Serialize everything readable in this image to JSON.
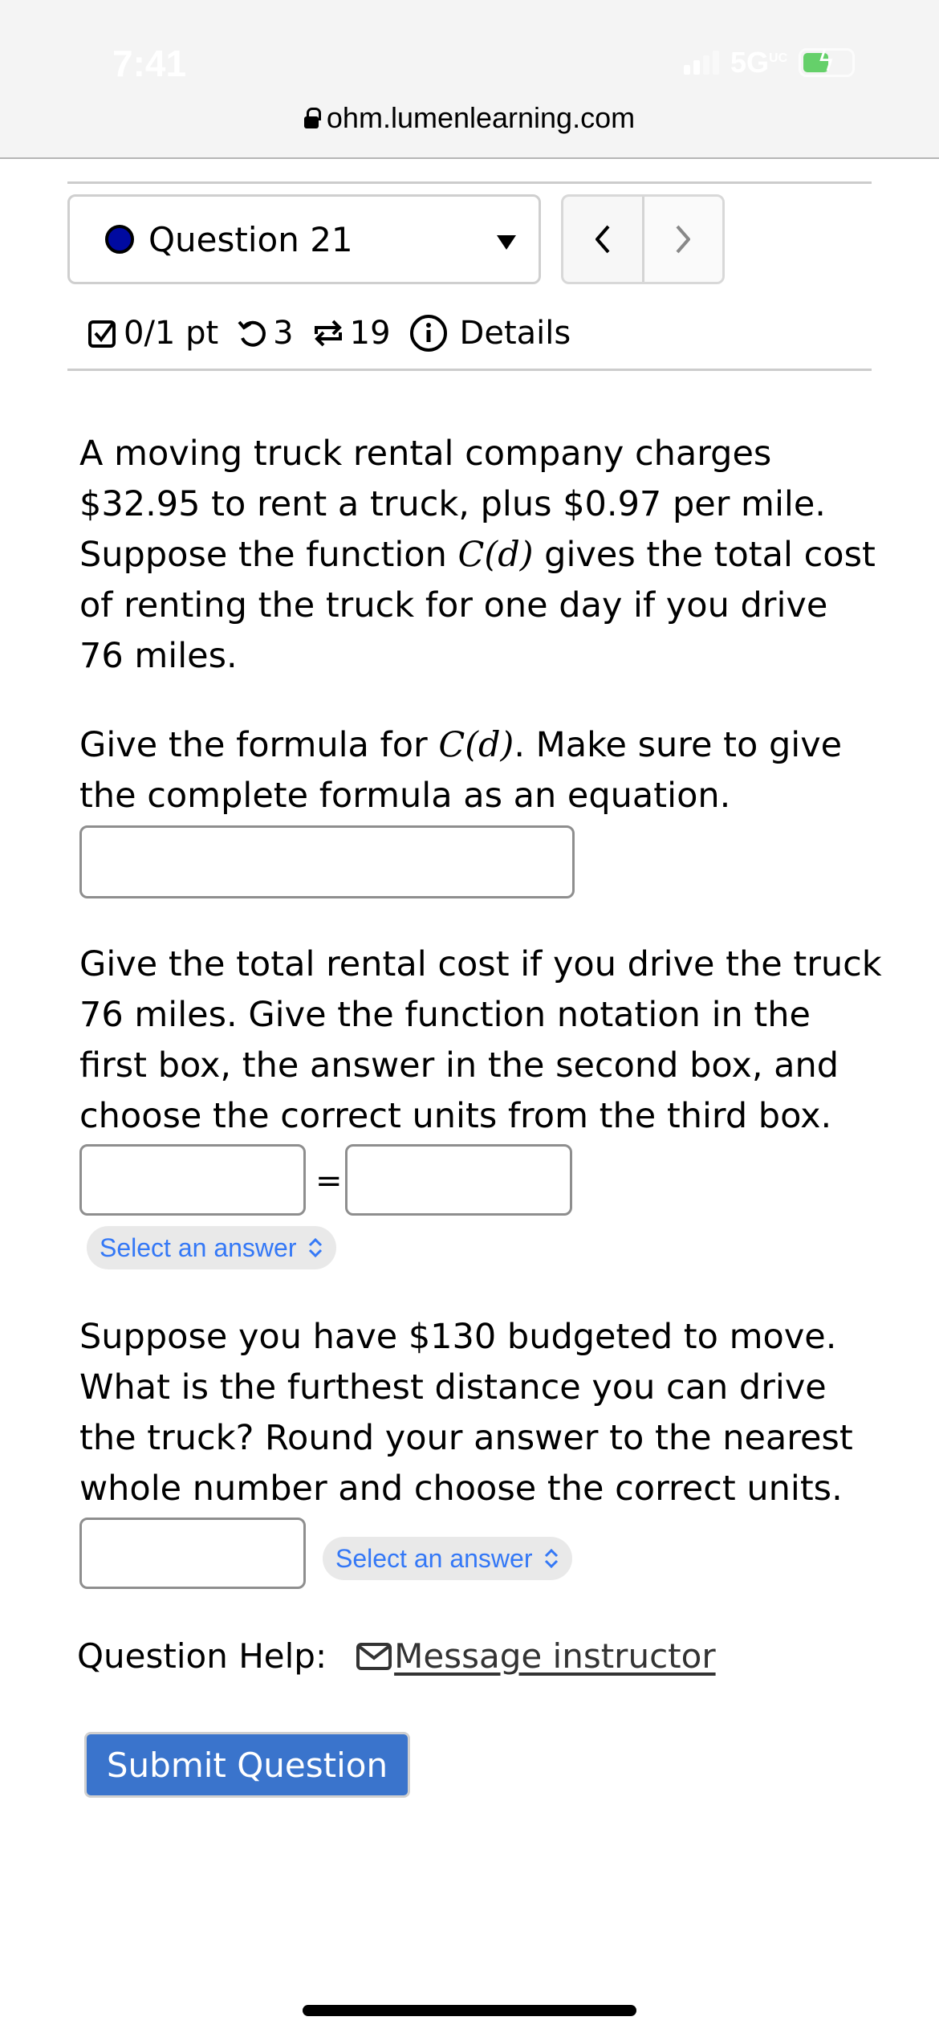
{
  "status_bar": {
    "time": "7:41",
    "network": "5G",
    "network_badge": "UC",
    "battery_charging": true
  },
  "browser": {
    "url": "ohm.lumenlearning.com"
  },
  "question_nav": {
    "selected_question": "Question 21",
    "prev_icon": "chevron-left-icon",
    "next_icon": "chevron-right-icon"
  },
  "meta": {
    "score": "0/1 pt",
    "attempts_left": "3",
    "versions": "19",
    "details_label": "Details"
  },
  "question": {
    "intro": {
      "before_math": "A moving truck rental company charges $32.95 to rent a truck, plus $0.97 per mile. Suppose the function ",
      "math": "C(d)",
      "after_math": " gives the total cost of renting the truck for one day if you drive 76 miles."
    },
    "part1": {
      "before_math": "Give the formula for ",
      "math": "C(d)",
      "after_math": ". Make sure to give the complete formula as an equation.",
      "input_value": ""
    },
    "part2": {
      "prompt": "Give the total rental cost if you drive the truck 76 miles. Give the function notation in the first box, the answer in the second box, and choose the correct units from the third box.",
      "input1_value": "",
      "equals": "=",
      "input2_value": "",
      "units_select": "Select an answer"
    },
    "part3": {
      "prompt": "Suppose you have $130 budgeted to move. What is the furthest distance you can drive the truck? Round your answer to the nearest whole number and choose the correct units.",
      "input_value": "",
      "units_select": "Select an answer"
    }
  },
  "help": {
    "label": "Question Help:",
    "message_link": "Message instructor"
  },
  "submit_label": "Submit Question",
  "colors": {
    "accent_blue": "#3a74cc",
    "select_text": "#3478f6",
    "status_dot": "#000aa0"
  }
}
